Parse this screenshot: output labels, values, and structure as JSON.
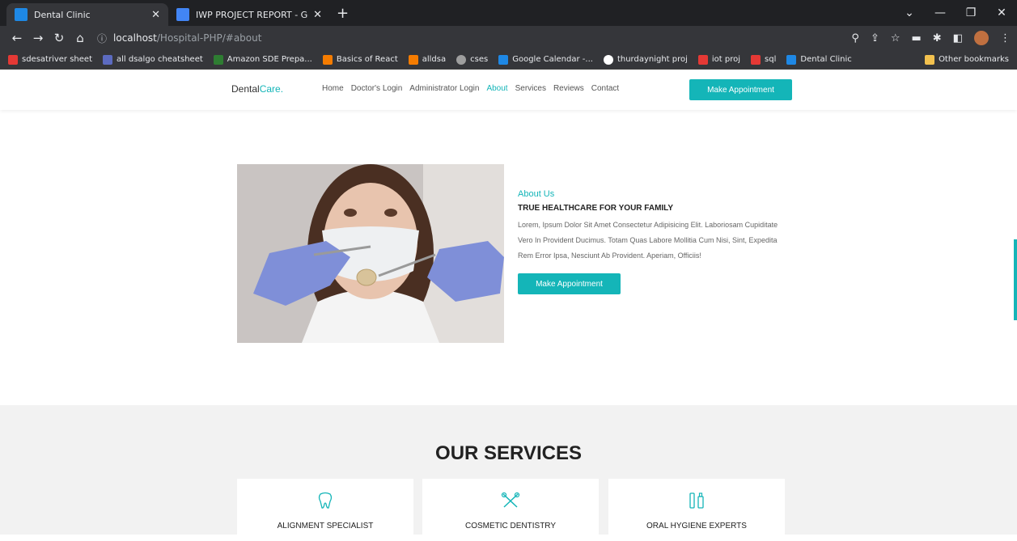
{
  "browser": {
    "tabs": [
      {
        "title": "Dental Clinic",
        "active": true
      },
      {
        "title": "IWP PROJECT REPORT - Google D",
        "active": false
      }
    ],
    "url_host": "localhost",
    "url_path": "/Hospital-PHP/#about",
    "bookmarks": [
      {
        "label": "sdesatriver sheet",
        "color": "#e53935"
      },
      {
        "label": "all dsalgo cheatsheet",
        "color": "#5c6bc0"
      },
      {
        "label": "Amazon SDE Prepa...",
        "color": "#2e7d32"
      },
      {
        "label": "Basics of React",
        "color": "#f57c00"
      },
      {
        "label": "alldsa",
        "color": "#f57c00"
      },
      {
        "label": "cses",
        "color": "#9e9e9e"
      },
      {
        "label": "Google Calendar -...",
        "color": "#1e88e5"
      },
      {
        "label": "thurdaynight proj",
        "color": "#ffffff"
      },
      {
        "label": "iot proj",
        "color": "#e53935"
      },
      {
        "label": "sql",
        "color": "#e53935"
      },
      {
        "label": "Dental Clinic",
        "color": "#1e88e5"
      }
    ],
    "other_bookmarks": "Other bookmarks"
  },
  "site": {
    "logo_main": "Dental",
    "logo_accent": "Care.",
    "menu": [
      "Home",
      "Doctor's Login",
      "Administrator Login",
      "About",
      "Services",
      "Reviews",
      "Contact"
    ],
    "active_menu": "About",
    "nav_button": "Make Appointment",
    "accent_color": "#14b5b8"
  },
  "about": {
    "label": "About Us",
    "title": "TRUE HEALTHCARE FOR YOUR FAMILY",
    "body": "Lorem, Ipsum Dolor Sit Amet Consectetur Adipisicing Elit. Laboriosam Cupiditate Vero In Provident Ducimus. Totam Quas Labore Mollitia Cum Nisi, Sint, Expedita Rem Error Ipsa, Nesciunt Ab Provident. Aperiam, Officiis!",
    "button": "Make Appointment"
  },
  "services": {
    "heading": "OUR SERVICES",
    "cards": [
      {
        "title": "ALIGNMENT SPECIALIST",
        "icon": "tooth-icon"
      },
      {
        "title": "COSMETIC DENTISTRY",
        "icon": "dental-tools-icon"
      },
      {
        "title": "ORAL HYGIENE EXPERTS",
        "icon": "toothbrush-paste-icon"
      }
    ]
  }
}
